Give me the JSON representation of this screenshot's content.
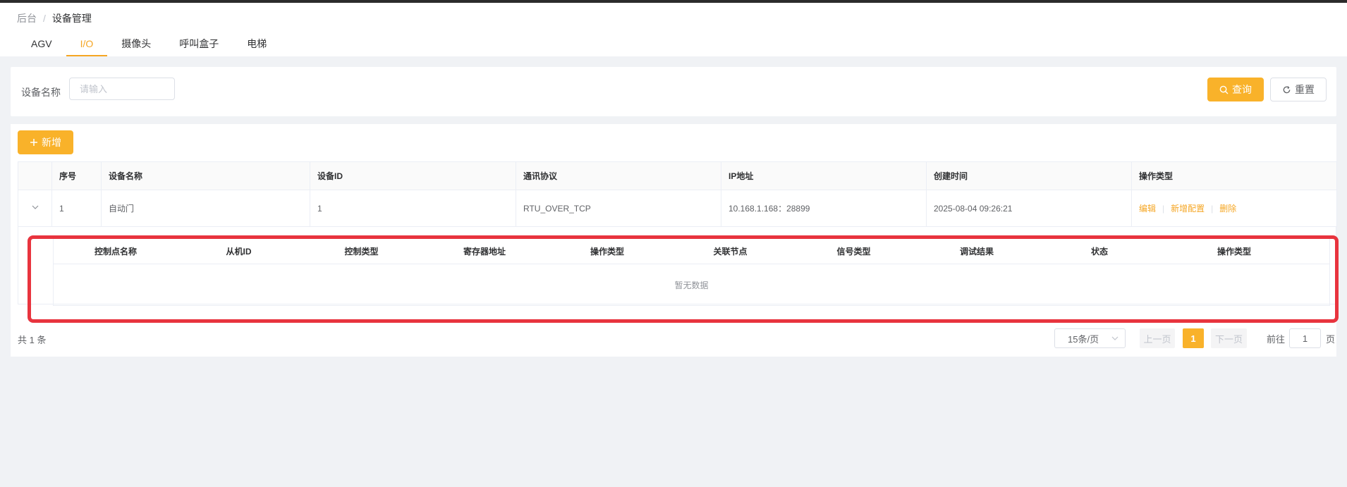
{
  "breadcrumb": {
    "root": "后台",
    "separator": "/",
    "current": "设备管理"
  },
  "tabs": [
    {
      "label": "AGV",
      "active": false
    },
    {
      "label": "I/O",
      "active": true
    },
    {
      "label": "摄像头",
      "active": false
    },
    {
      "label": "呼叫盒子",
      "active": false
    },
    {
      "label": "电梯",
      "active": false
    }
  ],
  "search": {
    "label": "设备名称",
    "placeholder": "请输入",
    "value": "",
    "query_label": "查询",
    "reset_label": "重置"
  },
  "toolbar": {
    "add_label": "新增"
  },
  "table": {
    "columns": [
      "",
      "序号",
      "设备名称",
      "设备ID",
      "通讯协议",
      "IP地址",
      "创建时间",
      "操作类型"
    ],
    "rows": [
      {
        "index": "1",
        "name": "自动门",
        "device_id": "1",
        "protocol": "RTU_OVER_TCP",
        "ip": "10.168.1.168：28899",
        "created": "2025-08-04 09:26:21",
        "actions": [
          "编辑",
          "新增配置",
          "删除"
        ]
      }
    ]
  },
  "sub_table": {
    "columns": [
      "控制点名称",
      "从机ID",
      "控制类型",
      "寄存器地址",
      "操作类型",
      "关联节点",
      "信号类型",
      "调试结果",
      "状态",
      "操作类型"
    ],
    "empty_text": "暂无数据"
  },
  "pagination": {
    "total_text": "共 1 条",
    "page_size": "15条/页",
    "prev": "上一页",
    "current_page": "1",
    "next": "下一页",
    "goto_label": "前往",
    "goto_value": "1",
    "goto_suffix": "页"
  },
  "colors": {
    "accent": "#f9b22a",
    "highlight": "#e8343e"
  }
}
